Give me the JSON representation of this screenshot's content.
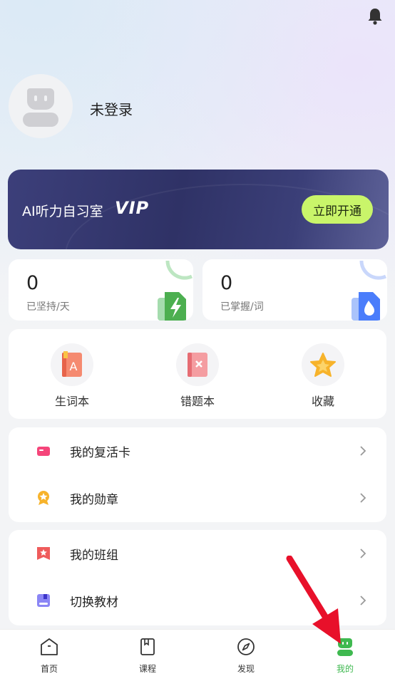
{
  "header": {
    "bell_icon": "bell-icon"
  },
  "profile": {
    "login_status": "未登录",
    "avatar_icon": "robot-avatar-icon"
  },
  "vip": {
    "title": "AI听力自习室",
    "badge": "VIP",
    "button": "立即开通",
    "accent": "#c9f56a"
  },
  "stats": [
    {
      "value": "0",
      "label": "已坚持/天",
      "icon": "lightning-icon",
      "color": "#4caf50"
    },
    {
      "value": "0",
      "label": "已掌握/词",
      "icon": "flame-icon",
      "color": "#4a7dfb"
    }
  ],
  "tools": [
    {
      "label": "生词本",
      "icon": "vocab-book-icon"
    },
    {
      "label": "错题本",
      "icon": "mistake-book-icon"
    },
    {
      "label": "收藏",
      "icon": "star-icon"
    }
  ],
  "menu1": [
    {
      "label": "我的复活卡",
      "icon": "card-icon"
    },
    {
      "label": "我的勋章",
      "icon": "medal-icon"
    }
  ],
  "menu2": [
    {
      "label": "我的班组",
      "icon": "class-group-icon"
    },
    {
      "label": "切换教材",
      "icon": "textbook-icon"
    }
  ],
  "tabs": [
    {
      "label": "首页",
      "icon": "home-icon"
    },
    {
      "label": "课程",
      "icon": "course-icon"
    },
    {
      "label": "发现",
      "icon": "compass-icon"
    },
    {
      "label": "我的",
      "icon": "profile-icon",
      "active": true,
      "active_color": "#3fb950"
    }
  ]
}
